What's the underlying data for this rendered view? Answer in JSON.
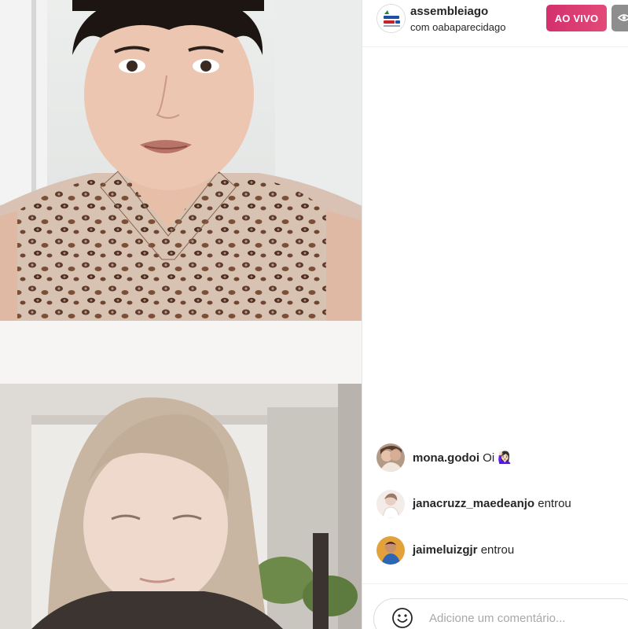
{
  "header": {
    "host_username": "assembleiago",
    "with_label": "com oabaparecidago",
    "live_label": "AO VIVO",
    "host_avatar_icon": "assembly-logo-icon",
    "viewers_icon": "eye-icon"
  },
  "comments": [
    {
      "username": "mona.godoi",
      "text": "Oi 🙋🏻‍♀️",
      "avatar_color": "#8c6c5a"
    },
    {
      "username": "janacruzz_maedeanjo",
      "text": "entrou",
      "avatar_color": "#d9c7c0"
    },
    {
      "username": "jaimeluizgjr",
      "text": "entrou",
      "avatar_color": "#3d6fa8"
    }
  ],
  "composer": {
    "placeholder": "Adicione um comentário...",
    "emoji_icon": "smiley-icon"
  },
  "colors": {
    "live_badge": "#d3306d",
    "viewers_badge": "#8e8e8e",
    "text": "#262626",
    "placeholder": "#a8a8a8"
  }
}
